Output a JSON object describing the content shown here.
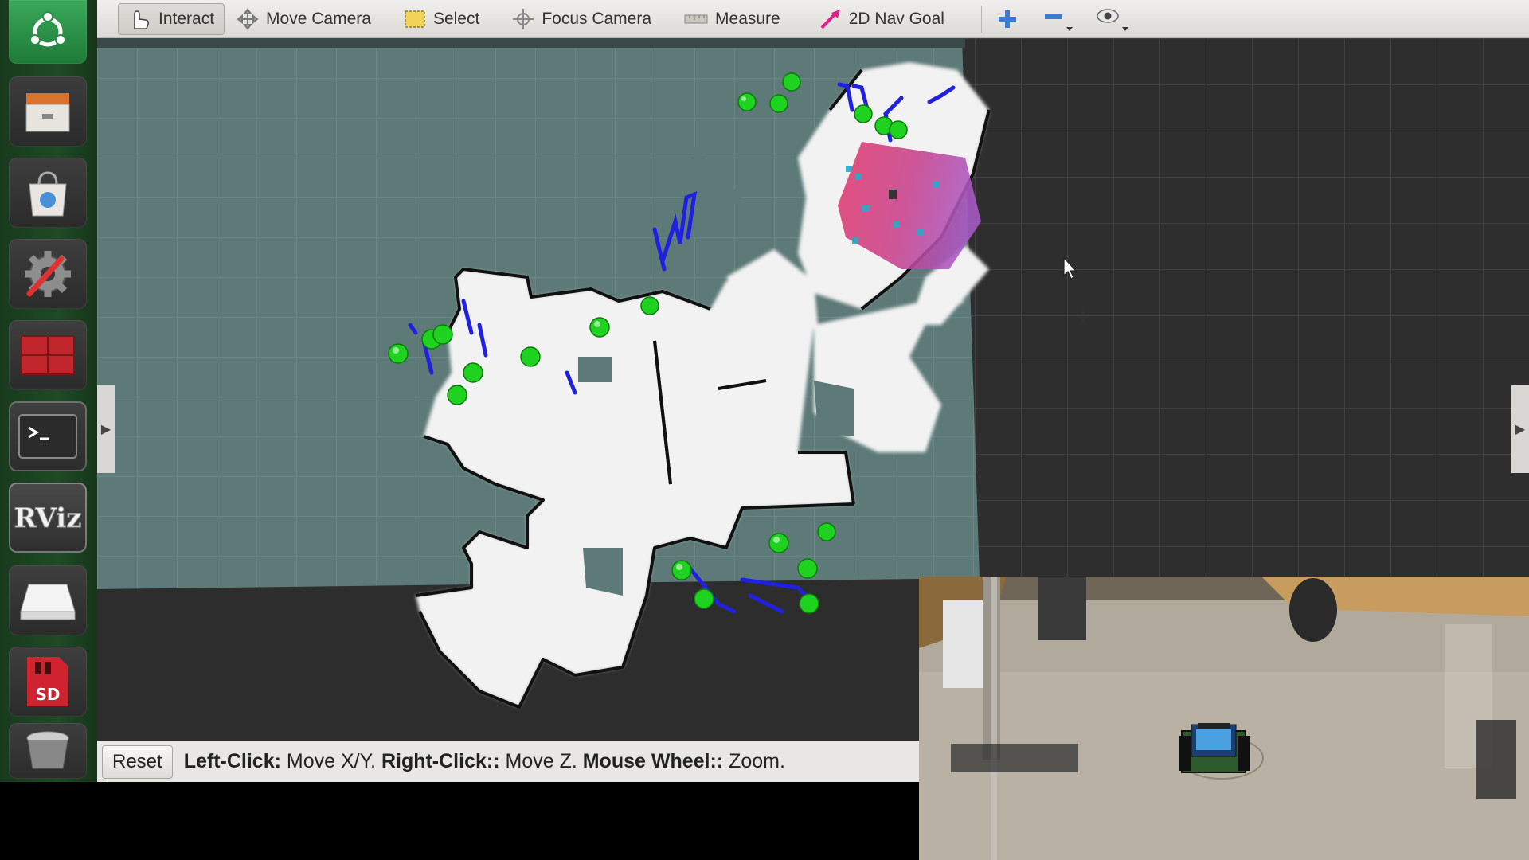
{
  "toolbar": {
    "tools": [
      {
        "label": "Interact",
        "icon": "hand-pointer-icon",
        "active": true
      },
      {
        "label": "Move Camera",
        "icon": "move-arrows-icon",
        "active": false
      },
      {
        "label": "Select",
        "icon": "select-rect-icon",
        "active": false
      },
      {
        "label": "Focus Camera",
        "icon": "crosshair-icon",
        "active": false
      },
      {
        "label": "Measure",
        "icon": "ruler-icon",
        "active": false
      },
      {
        "label": "2D Nav Goal",
        "icon": "nav-goal-arrow-icon",
        "active": false
      }
    ],
    "extra_icons": [
      "plus-icon",
      "minus-icon",
      "eye-icon"
    ]
  },
  "statusbar": {
    "reset_label": "Reset",
    "hint": [
      {
        "bold": "Left-Click:",
        "text": " Move X/Y. "
      },
      {
        "bold": "Right-Click::",
        "text": " Move Z. "
      },
      {
        "bold": "Mouse Wheel::",
        "text": " Zoom."
      }
    ]
  },
  "launcher": {
    "items": [
      {
        "name": "ubuntu-home-icon"
      },
      {
        "name": "files-icon"
      },
      {
        "name": "software-center-icon"
      },
      {
        "name": "system-settings-icon"
      },
      {
        "name": "system-monitor-icon"
      },
      {
        "name": "terminal-icon"
      },
      {
        "name": "rviz-icon",
        "text": "RViz"
      },
      {
        "name": "disk-drive-icon"
      },
      {
        "name": "sd-card-icon",
        "text": "SD"
      },
      {
        "name": "trash-icon"
      }
    ]
  },
  "colors": {
    "map_background": "#5d7a78",
    "free_space": "#f2f2f2",
    "obstacle": "#111111",
    "laser_scan": "#2020e0",
    "waypoint": "#1fd21f",
    "costmap": "#e23a6b",
    "toolbar": "#e6e4e0"
  }
}
